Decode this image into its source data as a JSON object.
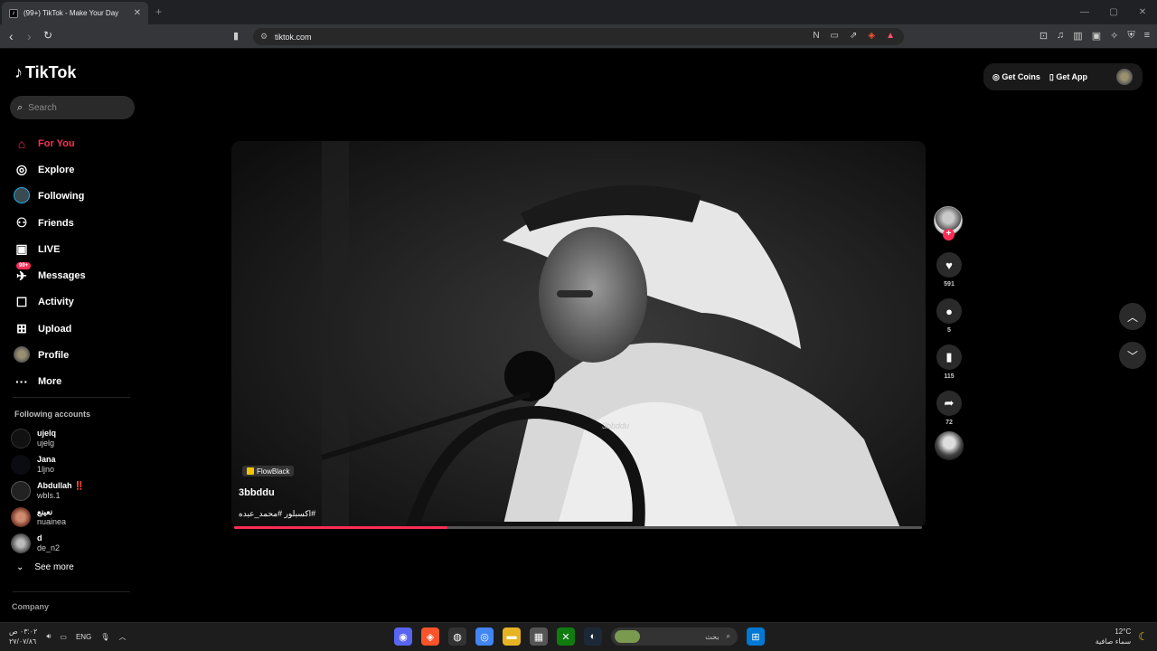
{
  "browser": {
    "tab_title": "(99+) TikTok - Make Your Day",
    "url": "tiktok.com",
    "window_controls": [
      "—",
      "▢",
      "✕"
    ]
  },
  "app": {
    "logo": "TikTok",
    "search_placeholder": "Search",
    "accent": "#fe2c55"
  },
  "sidebar": {
    "nav": [
      {
        "label": "For You",
        "icon": "home-icon",
        "active": true
      },
      {
        "label": "Explore",
        "icon": "compass-icon"
      },
      {
        "label": "Following",
        "icon": "following-avatar-icon"
      },
      {
        "label": "Friends",
        "icon": "friends-icon"
      },
      {
        "label": "LIVE",
        "icon": "live-icon"
      },
      {
        "label": "Messages",
        "icon": "messages-icon",
        "badge": "99+"
      },
      {
        "label": "Activity",
        "icon": "activity-icon"
      },
      {
        "label": "Upload",
        "icon": "upload-icon"
      },
      {
        "label": "Profile",
        "icon": "profile-avatar-icon"
      },
      {
        "label": "More",
        "icon": "more-icon"
      }
    ],
    "following_title": "Following accounts",
    "following": [
      {
        "name": "ujelq",
        "handle": "ujelg"
      },
      {
        "name": "Jana",
        "handle": "1ljno"
      },
      {
        "name": "Abdullah ‼️",
        "handle": "wbls.1"
      },
      {
        "name": "نعينع",
        "handle": "nuainea"
      },
      {
        "name": "d",
        "handle": "de_n2"
      }
    ],
    "see_more": "See more",
    "company": "Company"
  },
  "header": {
    "get_coins": "Get Coins",
    "get_app": "Get App"
  },
  "video": {
    "watermark": "3bbddu",
    "music_tag": "FlowBlack",
    "author": "3bbddu",
    "caption": "#اكسبلور #محمد_عبده",
    "progress": 0.31
  },
  "actions": {
    "likes": "591",
    "comments": "5",
    "saves": "115",
    "shares": "72"
  },
  "taskbar": {
    "time": "٠٣:٠٢ ص",
    "date": "٢٧/٠٧/٨٦",
    "lang": "ENG",
    "search_label": "بحث",
    "temp": "12°C",
    "weather": "سماء صافية"
  }
}
